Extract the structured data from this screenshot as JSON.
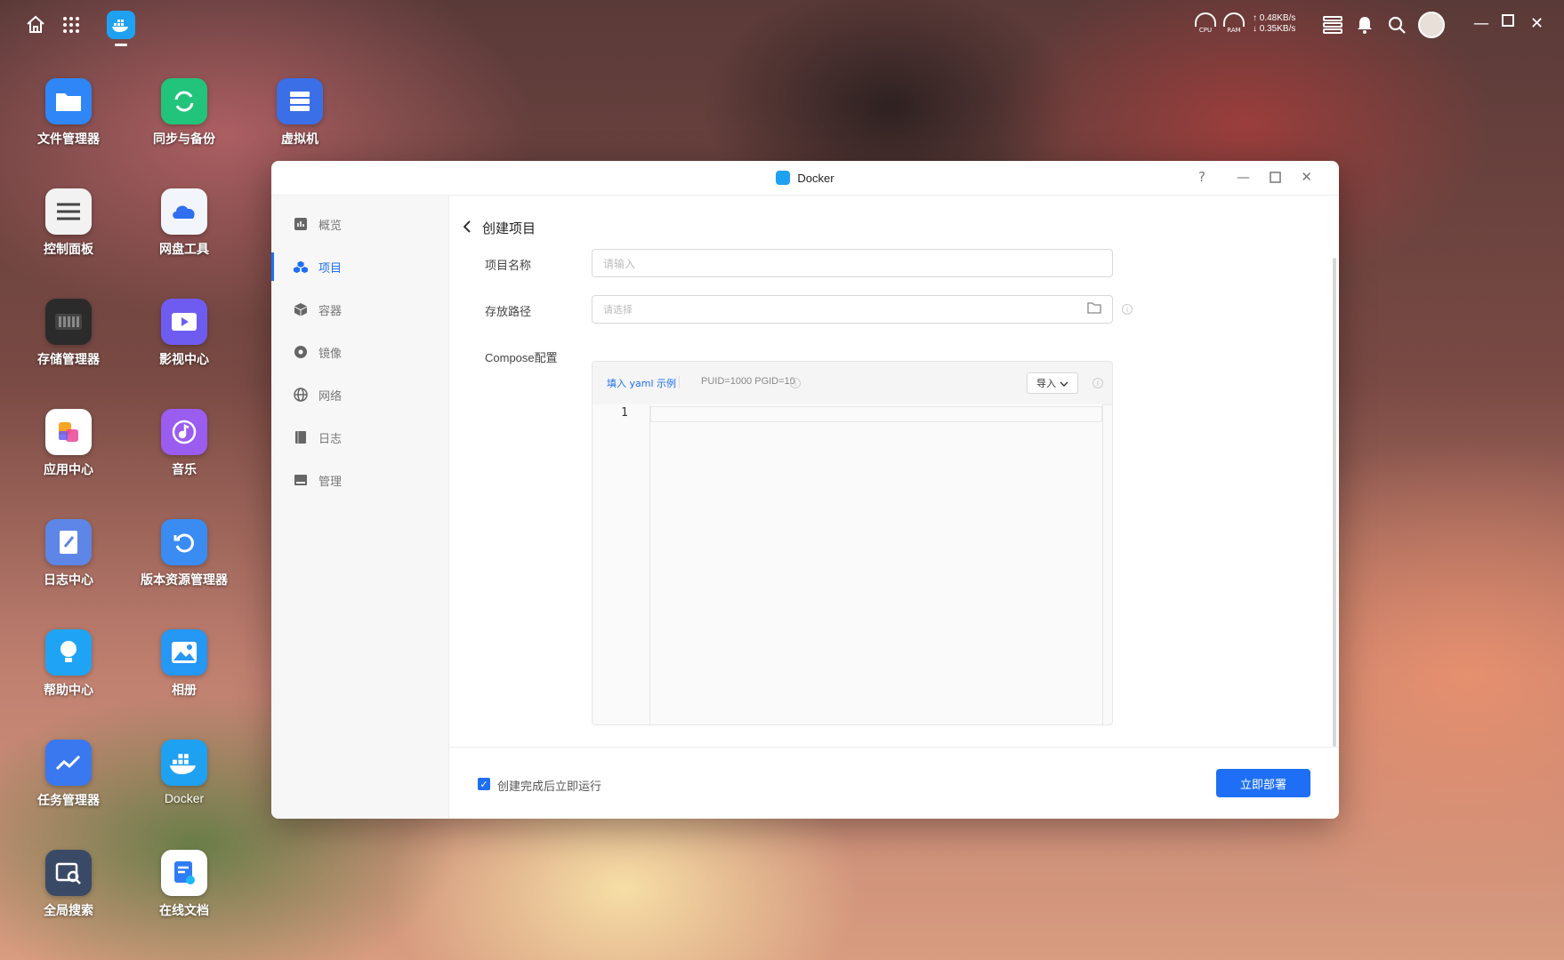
{
  "topbar": {
    "cpu_label": "CPU",
    "ram_label": "RAM",
    "net_up": "↑ 0.48KB/s",
    "net_down": "↓ 0.35KB/s"
  },
  "desktop": [
    {
      "label": "文件管理器",
      "color": "#2f86f6"
    },
    {
      "label": "同步与备份",
      "color": "#21c47a"
    },
    {
      "label": "虚拟机",
      "color": "#3b6fe8"
    },
    {
      "label": "控制面板",
      "color": "#f2f2f2"
    },
    {
      "label": "网盘工具",
      "color": "#f2f5fb"
    },
    {
      "label": "存储管理器",
      "color": "#2b2b2b"
    },
    {
      "label": "影视中心",
      "color": "#6e5cf0"
    },
    {
      "label": "应用中心",
      "color": "#ffffff"
    },
    {
      "label": "音乐",
      "color": "#9b5cf0"
    },
    {
      "label": "日志中心",
      "color": "#5e86e6"
    },
    {
      "label": "版本资源管理器",
      "color": "#3a8cf2"
    },
    {
      "label": "帮助中心",
      "color": "#1fa4f5"
    },
    {
      "label": "相册",
      "color": "#2597f5"
    },
    {
      "label": "任务管理器",
      "color": "#3a78f0"
    },
    {
      "label": "Docker",
      "color": "#1fa1f2"
    },
    {
      "label": "全局搜索",
      "color": "#3a4a66"
    },
    {
      "label": "在线文档",
      "color": "#ffffff"
    }
  ],
  "window": {
    "title": "Docker",
    "help": "?",
    "sidebar": [
      {
        "label": "概览",
        "icon": "overview-icon"
      },
      {
        "label": "项目",
        "icon": "project-icon"
      },
      {
        "label": "容器",
        "icon": "container-icon"
      },
      {
        "label": "镜像",
        "icon": "image-icon"
      },
      {
        "label": "网络",
        "icon": "network-icon"
      },
      {
        "label": "日志",
        "icon": "log-icon"
      },
      {
        "label": "管理",
        "icon": "manage-icon"
      }
    ],
    "page_title": "创建项目",
    "form": {
      "name_label": "项目名称",
      "name_placeholder": "请输入",
      "path_label": "存放路径",
      "path_placeholder": "请选择",
      "compose_label": "Compose配置",
      "fill_yaml": "填入 yaml 示例",
      "puid_hint": "PUID=1000 PGID=10",
      "import_label": "导入",
      "line_number": "1"
    },
    "footer": {
      "run_after_create": "创建完成后立即运行",
      "run_checked": true,
      "deploy_button": "立即部署"
    },
    "accent": "#1e6ff5"
  }
}
